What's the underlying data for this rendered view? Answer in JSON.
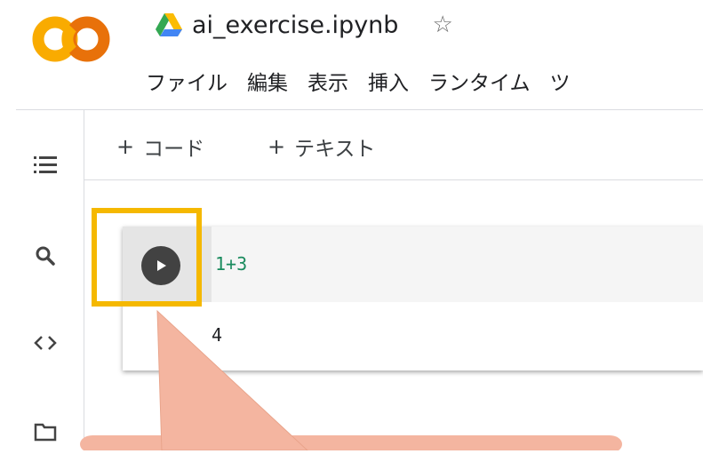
{
  "app": {
    "logo_name": "colab-logo",
    "title": "ai_exercise.ipynb",
    "star_icon": "star-outline-icon",
    "drive_icon": "google-drive-icon"
  },
  "menu": [
    "ファイル",
    "編集",
    "表示",
    "挿入",
    "ランタイム",
    "ツ"
  ],
  "sidebar": {
    "items": [
      {
        "icon": "table-of-contents-icon"
      },
      {
        "icon": "search-icon"
      },
      {
        "icon": "code-snippets-icon"
      },
      {
        "icon": "folder-icon"
      }
    ]
  },
  "toolbar": {
    "add_code_label": "コード",
    "add_text_label": "テキスト",
    "plus": "+"
  },
  "cell": {
    "code": "1+3",
    "output": "4",
    "run_icon": "play-icon"
  },
  "colors": {
    "highlight": "#f5b800",
    "callout": "#f4b5a0",
    "code_green": "#1a8b5e",
    "logo_orange": "#f9ab00",
    "logo_orange_dark": "#e8710a"
  }
}
